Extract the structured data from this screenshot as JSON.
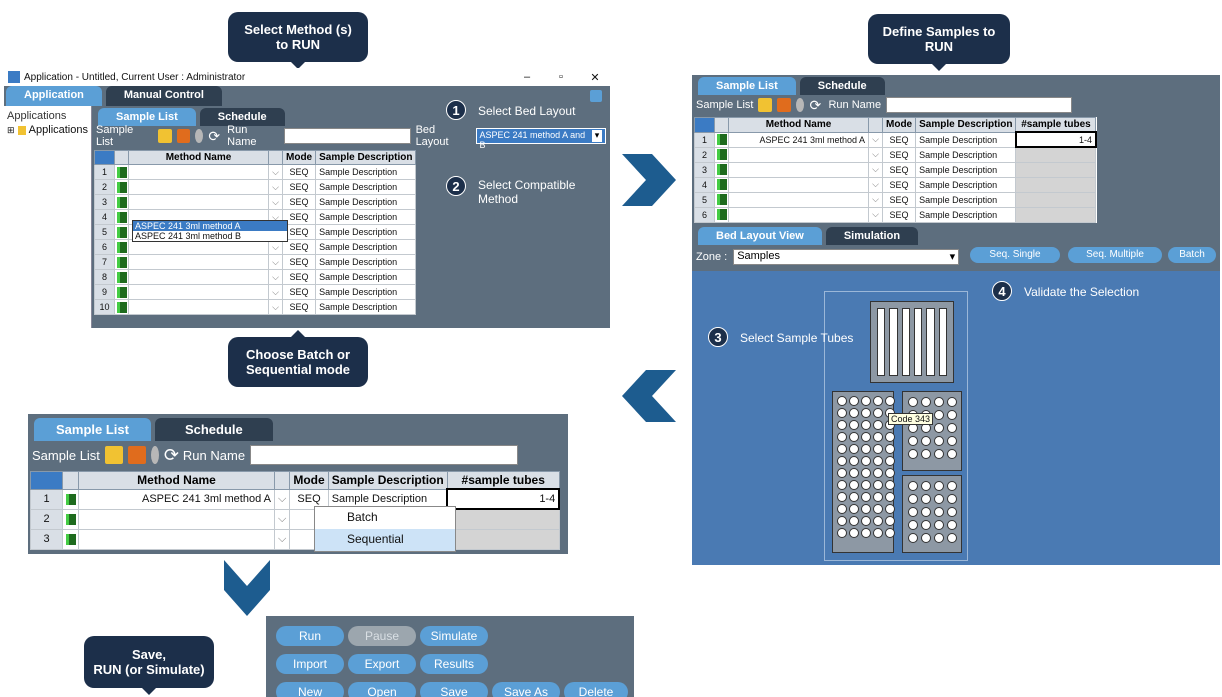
{
  "callouts": {
    "select_method": "Select Method (s)\nto RUN",
    "define_samples": "Define Samples to\nRUN",
    "choose_mode": "Choose Batch or\nSequential mode",
    "save_run": "Save,\nRUN (or Simulate)"
  },
  "window": {
    "title": "Application - Untitled, Current User : Administrator",
    "minimize": "–",
    "maximize": "▫",
    "close": "✕"
  },
  "main_tabs": [
    "Application",
    "Manual Control"
  ],
  "tree": {
    "header": "Applications",
    "item": "Applications"
  },
  "panel1": {
    "tabs": [
      "Sample List",
      "Schedule"
    ],
    "toolbar_label": "Sample List",
    "run_name_label": "Run Name",
    "bed_layout_label": "Bed Layout",
    "bed_layout_value": "ASPEC 241 method A and B",
    "columns": [
      "Method Name",
      "Mode",
      "Sample Description"
    ],
    "rows": [
      {
        "n": "1",
        "mode": "SEQ",
        "desc": "Sample Description",
        "method": ""
      },
      {
        "n": "2",
        "mode": "SEQ",
        "desc": "Sample Description",
        "method": ""
      },
      {
        "n": "3",
        "mode": "SEQ",
        "desc": "Sample Description",
        "method": ""
      },
      {
        "n": "4",
        "mode": "SEQ",
        "desc": "Sample Description",
        "method": ""
      },
      {
        "n": "5",
        "mode": "SEQ",
        "desc": "Sample Description",
        "method": ""
      },
      {
        "n": "6",
        "mode": "SEQ",
        "desc": "Sample Description",
        "method": ""
      },
      {
        "n": "7",
        "mode": "SEQ",
        "desc": "Sample Description",
        "method": ""
      },
      {
        "n": "8",
        "mode": "SEQ",
        "desc": "Sample Description",
        "method": ""
      },
      {
        "n": "9",
        "mode": "SEQ",
        "desc": "Sample Description",
        "method": ""
      },
      {
        "n": "10",
        "mode": "SEQ",
        "desc": "Sample Description",
        "method": ""
      }
    ],
    "dropdown_options": [
      "ASPEC 241 3ml method A",
      "ASPEC 241 3ml method B"
    ]
  },
  "steps": {
    "s1_num": "1",
    "s1_text": "Select Bed Layout",
    "s2_num": "2",
    "s2_text": "Select Compatible\nMethod",
    "s3_num": "3",
    "s3_text": "Select Sample Tubes",
    "s4_num": "4",
    "s4_text": "Validate  the Selection"
  },
  "panel2": {
    "tabs": [
      "Sample List",
      "Schedule"
    ],
    "toolbar_label": "Sample List",
    "run_name_label": "Run Name",
    "columns": [
      "Method Name",
      "Mode",
      "Sample Description",
      "#sample tubes"
    ],
    "rows": [
      {
        "n": "1",
        "method": "ASPEC 241 3ml method A",
        "mode": "SEQ",
        "desc": "Sample Description",
        "tubes": "1-4"
      },
      {
        "n": "2",
        "method": "",
        "mode": "SEQ",
        "desc": "Sample Description",
        "tubes": ""
      },
      {
        "n": "3",
        "method": "",
        "mode": "SEQ",
        "desc": "Sample Description",
        "tubes": ""
      },
      {
        "n": "4",
        "method": "",
        "mode": "SEQ",
        "desc": "Sample Description",
        "tubes": ""
      },
      {
        "n": "5",
        "method": "",
        "mode": "SEQ",
        "desc": "Sample Description",
        "tubes": ""
      },
      {
        "n": "6",
        "method": "",
        "mode": "SEQ",
        "desc": "Sample Description",
        "tubes": ""
      }
    ],
    "bed_tabs": [
      "Bed Layout View",
      "Simulation"
    ],
    "zone_label": "Zone :",
    "zone_value": "Samples",
    "seq_buttons": [
      "Seq. Single",
      "Seq. Multiple",
      "Batch"
    ],
    "tooltip": "Code 343"
  },
  "panel3": {
    "tabs": [
      "Sample List",
      "Schedule"
    ],
    "toolbar_label": "Sample List",
    "run_name_label": "Run Name",
    "columns": [
      "Method Name",
      "Mode",
      "Sample Description",
      "#sample tubes"
    ],
    "rows": [
      {
        "n": "1",
        "method": "ASPEC 241 3ml method A",
        "mode": "SEQ",
        "desc": "Sample Description",
        "tubes": "1-4"
      },
      {
        "n": "2",
        "method": "",
        "mode": "",
        "desc": "",
        "tubes": ""
      },
      {
        "n": "3",
        "method": "",
        "mode": "",
        "desc": "",
        "tubes": ""
      }
    ],
    "mode_options": [
      "Batch",
      "Sequential"
    ]
  },
  "action_buttons": {
    "run": "Run",
    "pause": "Pause",
    "simulate": "Simulate",
    "import": "Import",
    "export": "Export",
    "results": "Results",
    "new": "New",
    "open": "Open",
    "save": "Save",
    "save_as": "Save As",
    "delete": "Delete"
  },
  "colors": {
    "callout_bg": "#1c2f4a",
    "panel_bg": "#5d6e7e",
    "accent": "#5b9fd6",
    "bed_bg": "#4a7ab3"
  }
}
